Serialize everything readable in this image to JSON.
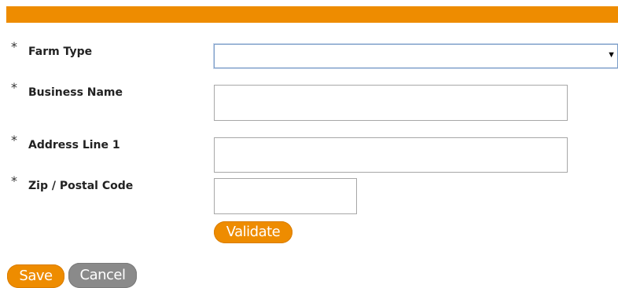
{
  "form": {
    "required_marker": "*",
    "farm_type": {
      "label": "Farm Type",
      "value": ""
    },
    "business_name": {
      "label": "Business Name",
      "value": ""
    },
    "address_line_1": {
      "label": "Address Line 1",
      "value": ""
    },
    "zip_postal_code": {
      "label": "Zip / Postal Code",
      "value": ""
    },
    "validate_label": "Validate"
  },
  "actions": {
    "save_label": "Save",
    "cancel_label": "Cancel"
  },
  "icons": {
    "select_arrow": "dropdown-arrow-icon"
  },
  "colors": {
    "accent": "#ee8c00",
    "secondary_button": "#8a8a8a"
  }
}
